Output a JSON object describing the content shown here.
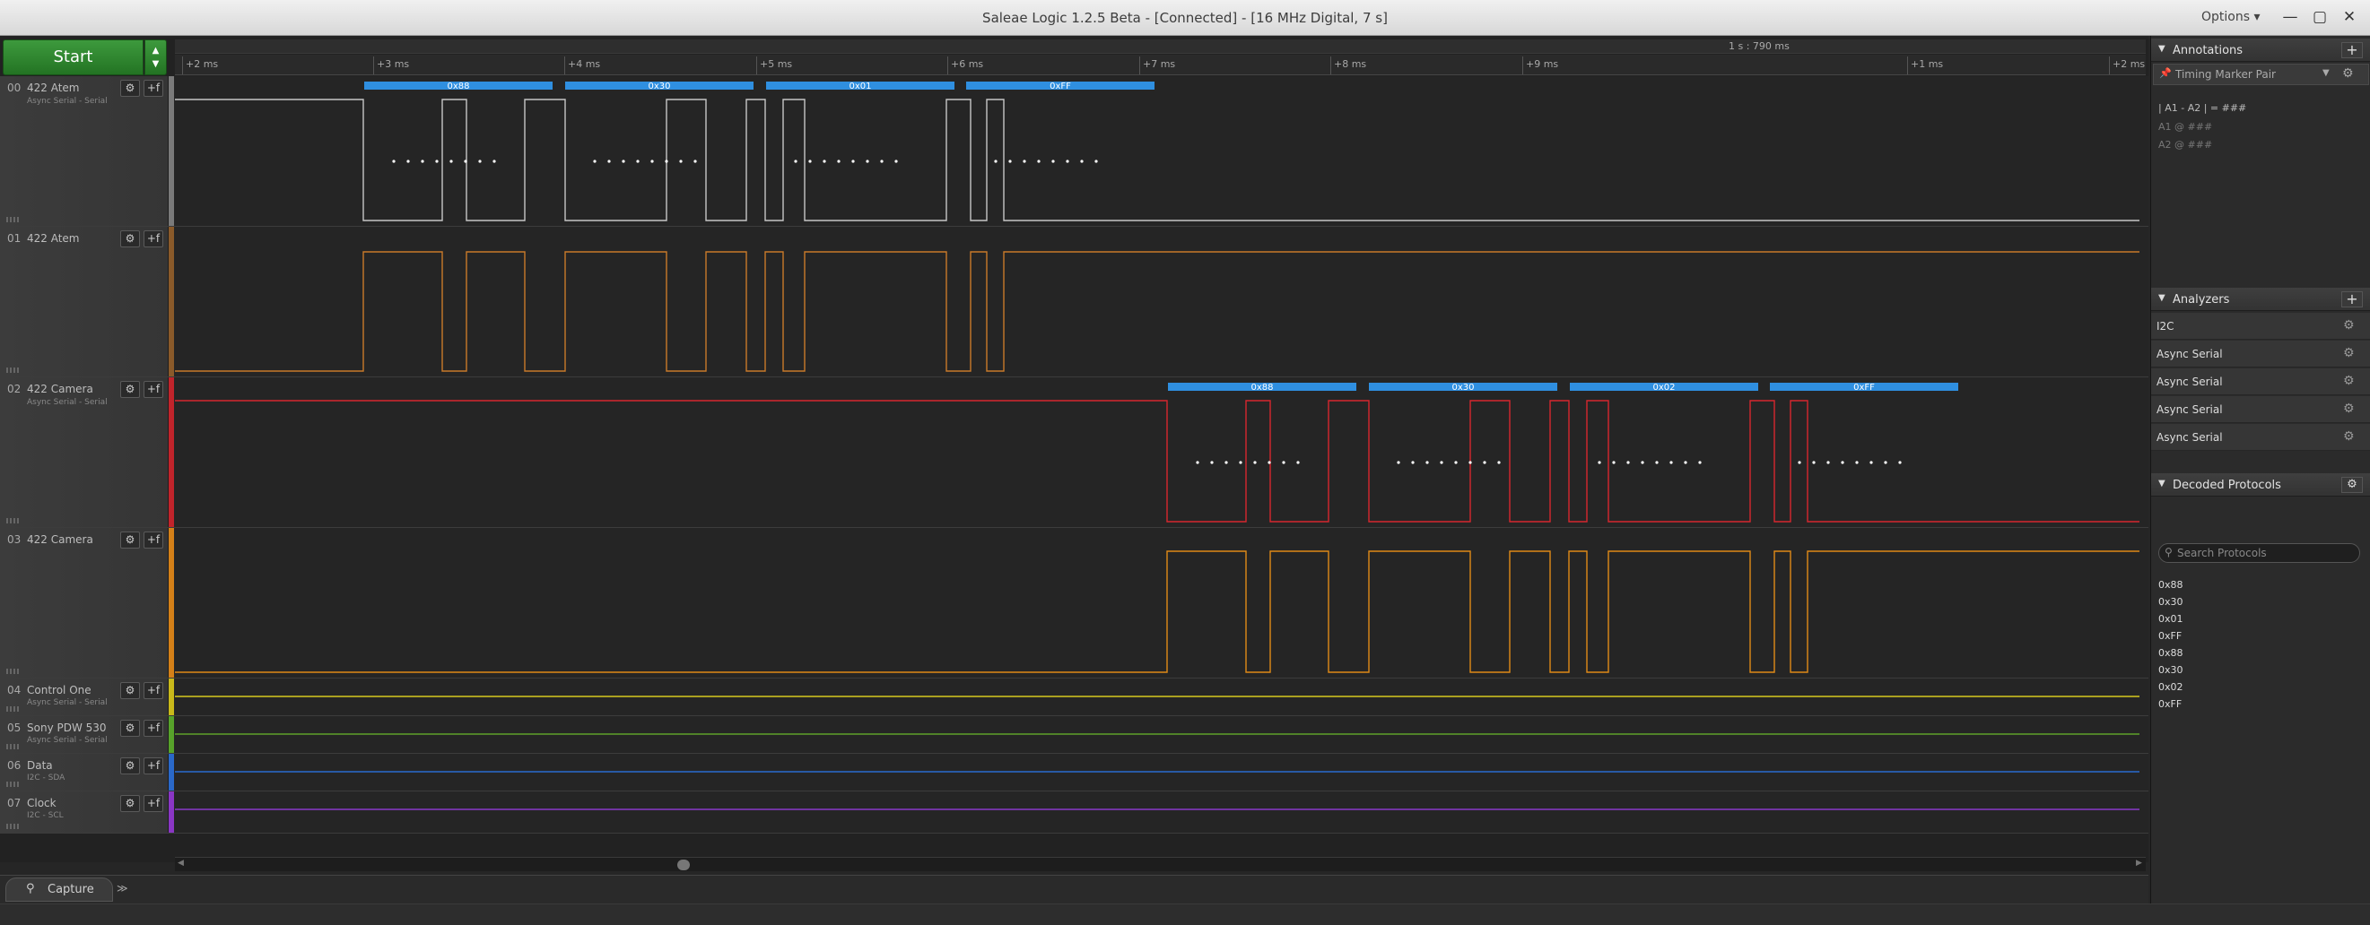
{
  "window": {
    "title": "Saleae Logic 1.2.5 Beta - [Connected] - [16 MHz Digital, 7 s]",
    "options_label": "Options ▾",
    "min_glyph": "—",
    "max_glyph": "▢",
    "close_glyph": "✕"
  },
  "start_button": {
    "label": "Start",
    "up": "▲",
    "down": "▼"
  },
  "ruler": {
    "duration": "1 s : 790 ms",
    "ticks": [
      "+2 ms",
      "+3 ms",
      "+4 ms",
      "+5 ms",
      "+6 ms",
      "+7 ms",
      "+8 ms",
      "+9 ms",
      "+1 ms",
      "+2 ms"
    ]
  },
  "channels": [
    {
      "num": "00",
      "name": "422 Atem",
      "sub": "Async Serial - Serial",
      "color": "#c7c7c7"
    },
    {
      "num": "01",
      "name": "422 Atem",
      "sub": "",
      "color": "#c87a2a"
    },
    {
      "num": "02",
      "name": "422 Camera",
      "sub": "Async Serial - Serial",
      "color": "#d7262e"
    },
    {
      "num": "03",
      "name": "422 Camera",
      "sub": "",
      "color": "#e08a17"
    },
    {
      "num": "04",
      "name": "Control One",
      "sub": "Async Serial - Serial",
      "color": "#d6c91e"
    },
    {
      "num": "05",
      "name": "Sony PDW 530",
      "sub": "Async Serial - Serial",
      "color": "#5fa22a"
    },
    {
      "num": "06",
      "name": "Data",
      "sub": "I2C - SDA",
      "color": "#2a6bd0"
    },
    {
      "num": "07",
      "name": "Clock",
      "sub": "I2C - SCL",
      "color": "#8a3ac9"
    }
  ],
  "channel_buttons": {
    "settings_glyph": "⚙",
    "plus_glyph": "+f"
  },
  "decoded_bubbles": {
    "ch0": [
      "0x88",
      "0x30",
      "0x01",
      "0xFF"
    ],
    "ch2": [
      "0x88",
      "0x30",
      "0x02",
      "0xFF"
    ]
  },
  "bottom": {
    "capture_label": "Capture",
    "capture_icon": "magnifier-icon",
    "more": "≫"
  },
  "side": {
    "annotations": {
      "title": "Annotations",
      "timing_marker": "Timing Marker Pair",
      "pair_line": "| A1 - A2 | = ###",
      "a1": "A1  @  ###",
      "a2": "A2  @  ###"
    },
    "analyzers": {
      "title": "Analyzers",
      "items": [
        "I2C",
        "Async Serial",
        "Async Serial",
        "Async Serial",
        "Async Serial"
      ]
    },
    "decoded": {
      "title": "Decoded Protocols",
      "search_placeholder": "Search Protocols",
      "items": [
        "0x88",
        "0x30",
        "0x01",
        "0xFF",
        "0x88",
        "0x30",
        "0x02",
        "0xFF"
      ]
    }
  }
}
